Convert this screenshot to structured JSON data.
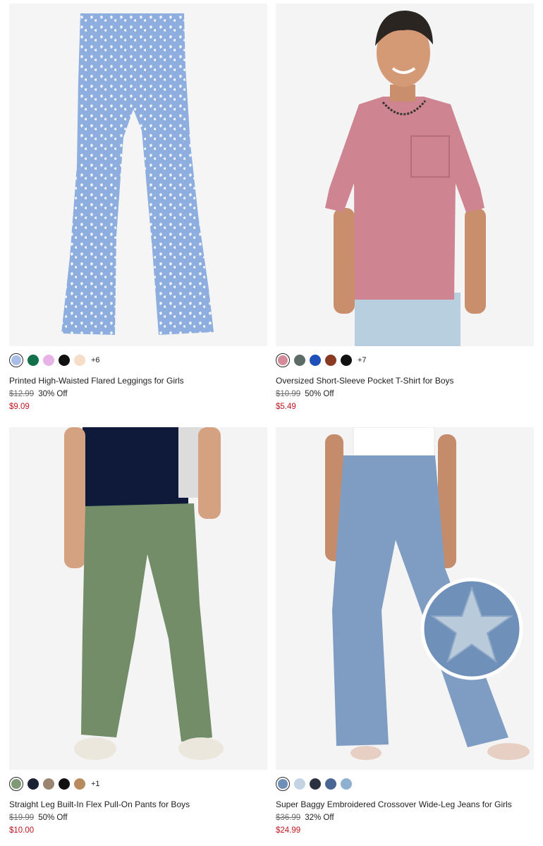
{
  "products": [
    {
      "title": "Printed High-Waisted Flared Leggings for Girls",
      "original_price": "$12.99",
      "discount": "30% Off",
      "sale_price": "$9.09",
      "more_colors": "+6",
      "swatches": [
        "#a9bde6",
        "#12704a",
        "#e7b3e6",
        "#111111",
        "#f7dcc8"
      ],
      "image_icon": "flared-leggings-image"
    },
    {
      "title": "Oversized Short-Sleeve Pocket T-Shirt for Boys",
      "original_price": "$10.99",
      "discount": "50% Off",
      "sale_price": "$5.49",
      "more_colors": "+7",
      "swatches": [
        "#d58b99",
        "#5b6b66",
        "#1f4fb8",
        "#8a3a22",
        "#111111"
      ],
      "image_icon": "pocket-tshirt-image"
    },
    {
      "title": "Straight Leg Built-In Flex Pull-On Pants for Boys",
      "original_price": "$19.99",
      "discount": "50% Off",
      "sale_price": "$10.00",
      "more_colors": "+1",
      "swatches": [
        "#7f9a74",
        "#1b2233",
        "#9b8470",
        "#111111",
        "#b88a5c"
      ],
      "image_icon": "pull-on-pants-image"
    },
    {
      "title": "Super Baggy Embroidered Crossover Wide-Leg Jeans for Girls",
      "original_price": "$36.99",
      "discount": "32% Off",
      "sale_price": "$24.99",
      "more_colors": "",
      "swatches": [
        "#6d8fb8",
        "#c3d3e2",
        "#2a3240",
        "#4a6694",
        "#8fb0cf"
      ],
      "image_icon": "wide-leg-jeans-image"
    }
  ]
}
